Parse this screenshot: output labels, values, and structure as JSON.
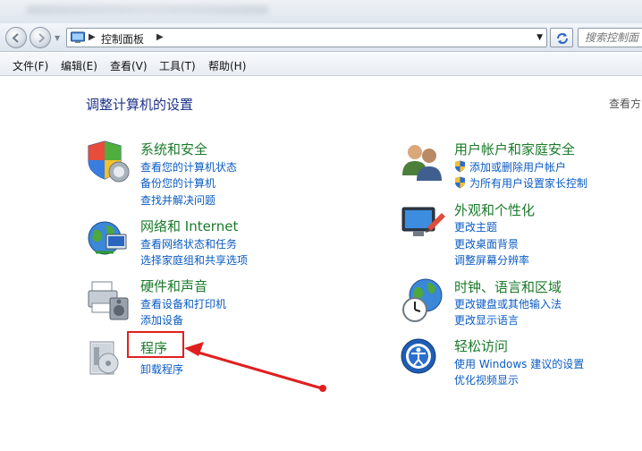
{
  "navigation": {
    "breadcrumb": "控制面板",
    "search_placeholder": "搜索控制面"
  },
  "menu": [
    {
      "label": "文件(F)"
    },
    {
      "label": "编辑(E)"
    },
    {
      "label": "查看(V)"
    },
    {
      "label": "工具(T)"
    },
    {
      "label": "帮助(H)"
    }
  ],
  "main": {
    "title": "调整计算机的设置",
    "view_by": "查看方",
    "left_categories": [
      {
        "title": "系统和安全",
        "links": [
          "查看您的计算机状态",
          "备份您的计算机",
          "查找并解决问题"
        ]
      },
      {
        "title": "网络和 Internet",
        "links": [
          "查看网络状态和任务",
          "选择家庭组和共享选项"
        ]
      },
      {
        "title": "硬件和声音",
        "links": [
          "查看设备和打印机",
          "添加设备"
        ]
      },
      {
        "title": "程序",
        "links": [
          "卸载程序"
        ]
      }
    ],
    "right_categories": [
      {
        "title": "用户帐户和家庭安全",
        "links": [
          "添加或删除用户帐户",
          "为所有用户设置家长控制"
        ]
      },
      {
        "title": "外观和个性化",
        "links": [
          "更改主题",
          "更改桌面背景",
          "调整屏幕分辨率"
        ]
      },
      {
        "title": "时钟、语言和区域",
        "links": [
          "更改键盘或其他输入法",
          "更改显示语言"
        ]
      },
      {
        "title": "轻松访问",
        "links": [
          "使用 Windows 建议的设置",
          "优化视频显示"
        ]
      }
    ]
  },
  "colors": {
    "category_title": "#1a7a2a",
    "link": "#0a5bc4",
    "page_title": "#1e3287",
    "highlight": "#e02020"
  }
}
